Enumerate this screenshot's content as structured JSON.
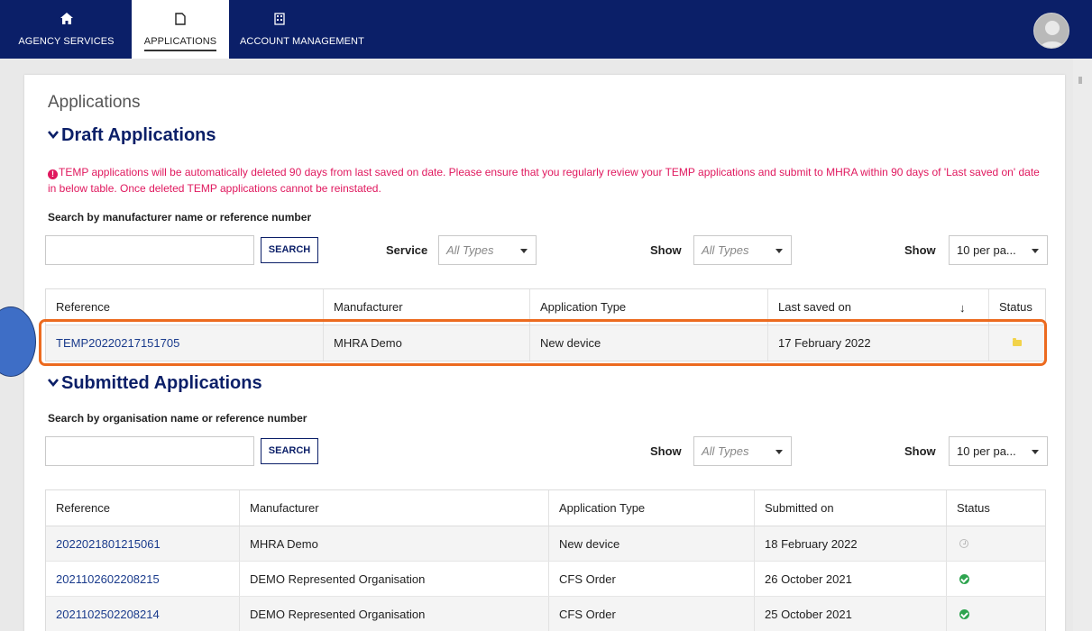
{
  "nav": {
    "items": [
      {
        "label": "AGENCY SERVICES",
        "icon": "home-icon"
      },
      {
        "label": "APPLICATIONS",
        "icon": "document-icon",
        "active": true
      },
      {
        "label": "ACCOUNT MANAGEMENT",
        "icon": "building-icon"
      }
    ],
    "brand_color": "#0b1f68"
  },
  "page": {
    "title": "Applications"
  },
  "draft": {
    "section_title": "Draft Applications",
    "warning": "TEMP applications will be automatically deleted 90 days from last saved on date. Please ensure that you regularly review your TEMP applications and submit to MHRA within 90 days of 'Last saved on' date in below table. Once deleted TEMP applications cannot be reinstated.",
    "warning_color": "#e0185e",
    "search_label": "Search by manufacturer name or reference number",
    "search_value": "",
    "search_button": "SEARCH",
    "filter_service_label": "Service",
    "filter_service_value": "All Types",
    "filter_show_label": "Show",
    "filter_show_value": "All Types",
    "filter_page_label": "Show",
    "filter_page_value": "10 per pa...",
    "columns": [
      "Reference",
      "Manufacturer",
      "Application Type",
      "Last saved on",
      "Status"
    ],
    "rows": [
      {
        "reference": "TEMP20220217151705",
        "manufacturer": "MHRA Demo",
        "type": "New device",
        "date": "17 February 2022",
        "status_icon": "folder-icon"
      }
    ],
    "highlight_color": "#ec6a1f"
  },
  "submitted": {
    "section_title": "Submitted Applications",
    "search_label": "Search by organisation name or reference number",
    "search_value": "",
    "search_button": "SEARCH",
    "filter_show_label": "Show",
    "filter_show_value": "All Types",
    "filter_page_label": "Show",
    "filter_page_value": "10 per pa...",
    "columns": [
      "Reference",
      "Manufacturer",
      "Application Type",
      "Submitted on",
      "Status"
    ],
    "rows": [
      {
        "reference": "2022021801215061",
        "manufacturer": "MHRA Demo",
        "type": "New device",
        "date": "18 February 2022",
        "status_icon": "clock-icon"
      },
      {
        "reference": "2021102602208215",
        "manufacturer": "DEMO Represented Organisation",
        "type": "CFS Order",
        "date": "26 October 2021",
        "status_icon": "check-icon"
      },
      {
        "reference": "2021102502208214",
        "manufacturer": "DEMO Represented Organisation",
        "type": "CFS Order",
        "date": "25 October 2021",
        "status_icon": "check-icon"
      }
    ]
  }
}
